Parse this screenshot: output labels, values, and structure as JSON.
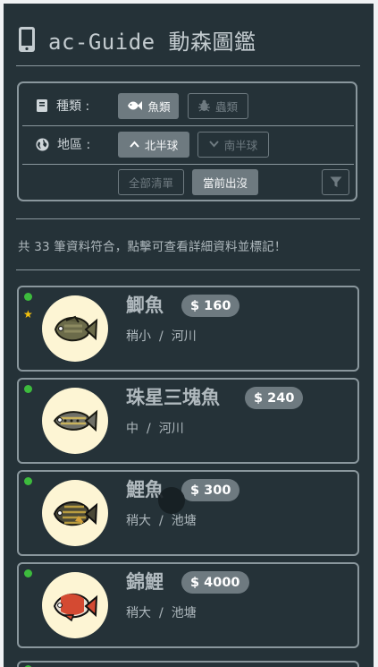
{
  "header": {
    "title": "ac-Guide 動森圖鑑",
    "icon": "mobile-phone-icon"
  },
  "filters": {
    "category": {
      "label": "種類 :",
      "options": [
        {
          "label": "魚類",
          "icon": "fish-icon",
          "selected": true
        },
        {
          "label": "蟲類",
          "icon": "bug-icon",
          "selected": false
        }
      ]
    },
    "region": {
      "label": "地區 :",
      "options": [
        {
          "label": "北半球",
          "icon": "chevron-up-icon",
          "selected": true
        },
        {
          "label": "南半球",
          "icon": "chevron-down-icon",
          "selected": false
        }
      ]
    },
    "scope": {
      "options": [
        {
          "label": "全部清單",
          "selected": false
        },
        {
          "label": "當前出沒",
          "selected": true
        }
      ],
      "filter_icon": "filter-icon"
    }
  },
  "result_text": "共 33 筆資料符合，點擊可查看詳細資料並標記！",
  "fish": [
    {
      "name": "鯽魚",
      "price": "$ 160",
      "size": "稍小",
      "location": "河川",
      "available": true,
      "starred": true,
      "color": "#6b6b4a"
    },
    {
      "name": "珠星三塊魚",
      "price": "$ 240",
      "size": "中",
      "location": "河川",
      "available": true,
      "starred": false,
      "color": "#6f7068"
    },
    {
      "name": "鯉魚",
      "price": "$ 300",
      "size": "稍大",
      "location": "池塘",
      "available": true,
      "starred": false,
      "color": "#4a4836"
    },
    {
      "name": "錦鯉",
      "price": "$ 4000",
      "size": "稍大",
      "location": "池塘",
      "available": true,
      "starred": false,
      "color": "#d44a32"
    }
  ],
  "colors": {
    "background": "#253238",
    "accent_green": "#3dbb3d",
    "star_yellow": "#f4c20d",
    "pill": "#6e7a80"
  }
}
